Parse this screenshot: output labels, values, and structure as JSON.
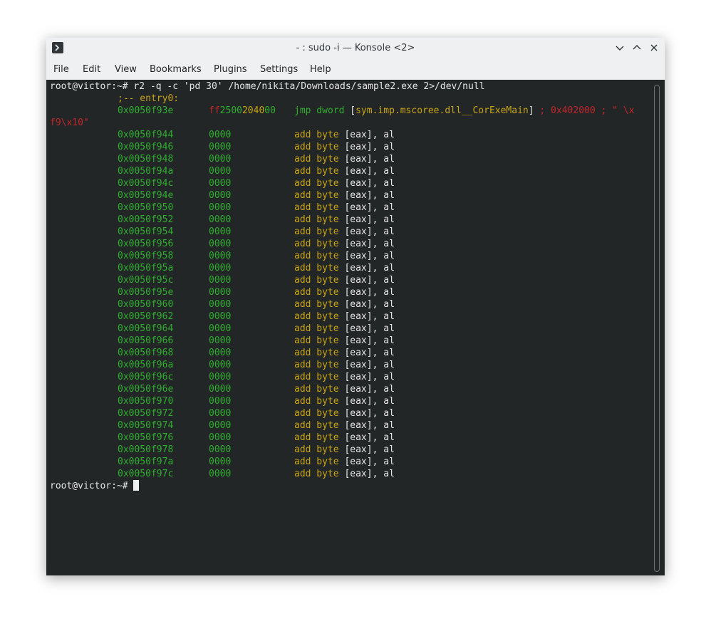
{
  "window": {
    "title": "- : sudo -i — Konsole <2>"
  },
  "menu": [
    "File",
    "Edit",
    "View",
    "Bookmarks",
    "Plugins",
    "Settings",
    "Help"
  ],
  "terminal": {
    "command_prompt": "root@victor:~# ",
    "command": "r2 -q -c 'pd 30' /home/nikita/Downloads/sample2.exe 2>/dev/null",
    "entry_label": ";-- entry0:",
    "first": {
      "address": "0x0050f93e",
      "bytes_a": "ff",
      "bytes_b": "25",
      "bytes_c": "00",
      "bytes_d": "20",
      "bytes_e": "40",
      "bytes_f": "00",
      "mnemonic": "jmp dword",
      "operand_open": "[",
      "symbol": "sym.imp.mscoree.dll__CorExeMain",
      "operand_close": "]",
      "comment": " ; 0x402000 ; \" \\x",
      "comment_wrap": "f9\\x10\""
    },
    "rows": [
      "0x0050f944",
      "0x0050f946",
      "0x0050f948",
      "0x0050f94a",
      "0x0050f94c",
      "0x0050f94e",
      "0x0050f950",
      "0x0050f952",
      "0x0050f954",
      "0x0050f956",
      "0x0050f958",
      "0x0050f95a",
      "0x0050f95c",
      "0x0050f95e",
      "0x0050f960",
      "0x0050f962",
      "0x0050f964",
      "0x0050f966",
      "0x0050f968",
      "0x0050f96a",
      "0x0050f96c",
      "0x0050f96e",
      "0x0050f970",
      "0x0050f972",
      "0x0050f974",
      "0x0050f976",
      "0x0050f978",
      "0x0050f97a",
      "0x0050f97c"
    ],
    "row_bytes": "0000",
    "row_mnemonic": "add byte",
    "row_operand": "[eax], al",
    "final_prompt": "root@victor:~# "
  }
}
